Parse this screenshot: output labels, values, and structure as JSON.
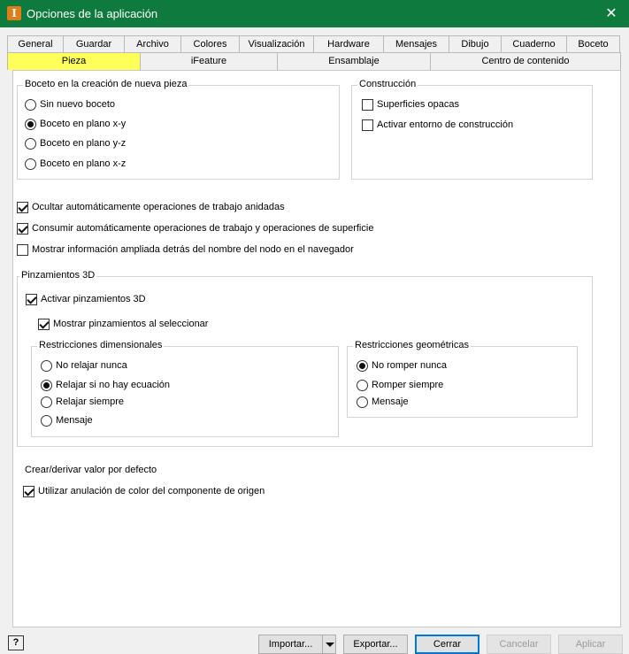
{
  "window": {
    "title": "Opciones de la aplicación",
    "icon": "inventor-app-icon",
    "icon_glyph": "I",
    "close_glyph": "✕",
    "accent_color": "#0e7a3d"
  },
  "tabs_row1": [
    {
      "label": "General"
    },
    {
      "label": "Guardar"
    },
    {
      "label": "Archivo"
    },
    {
      "label": "Colores"
    },
    {
      "label": "Visualización"
    },
    {
      "label": "Hardware"
    },
    {
      "label": "Mensajes"
    },
    {
      "label": "Dibujo"
    },
    {
      "label": "Cuaderno"
    },
    {
      "label": "Boceto"
    }
  ],
  "tabs_row2": [
    {
      "label": "Pieza",
      "active": true
    },
    {
      "label": "iFeature"
    },
    {
      "label": "Ensamblaje"
    },
    {
      "label": "Centro de contenido"
    }
  ],
  "sketch_group": {
    "legend": "Boceto en la creación de nueva pieza",
    "options": [
      {
        "label": "Sin nuevo boceto",
        "selected": false
      },
      {
        "label": "Boceto en plano x-y",
        "selected": true
      },
      {
        "label": "Boceto en plano y-z",
        "selected": false
      },
      {
        "label": "Boceto en plano x-z",
        "selected": false
      }
    ]
  },
  "construction_group": {
    "legend": "Construcción",
    "options": [
      {
        "label": "Superficies opacas",
        "checked": false
      },
      {
        "label": "Activar entorno de construcción",
        "checked": false
      }
    ]
  },
  "general_checks": [
    {
      "label": "Ocultar automáticamente operaciones de trabajo anidadas",
      "checked": true
    },
    {
      "label": "Consumir automáticamente operaciones de trabajo y operaciones de superficie",
      "checked": true
    },
    {
      "label": "Mostrar información ampliada detrás del nombre del nodo en el navegador",
      "checked": false
    }
  ],
  "grips_group": {
    "legend": "Pinzamientos 3D",
    "enable": {
      "label": "Activar pinzamientos 3D",
      "checked": true
    },
    "show_on_select": {
      "label": "Mostrar pinzamientos al seleccionar",
      "checked": true
    },
    "dimensional": {
      "legend": "Restricciones dimensionales",
      "options": [
        {
          "label": "No relajar nunca",
          "selected": false
        },
        {
          "label": "Relajar si no hay ecuación",
          "selected": true
        },
        {
          "label": "Relajar siempre",
          "selected": false
        },
        {
          "label": "Mensaje",
          "selected": false
        }
      ]
    },
    "geometric": {
      "legend": "Restricciones geométricas",
      "options": [
        {
          "label": "No romper nunca",
          "selected": true
        },
        {
          "label": "Romper siempre",
          "selected": false
        },
        {
          "label": "Mensaje",
          "selected": false
        }
      ]
    }
  },
  "derive": {
    "heading": "Crear/derivar valor por defecto",
    "option": {
      "label": "Utilizar anulación de color del componente de origen",
      "checked": true
    }
  },
  "buttons": {
    "help": "?",
    "import": "Importar...",
    "export": "Exportar...",
    "close": "Cerrar",
    "cancel": "Cancelar",
    "apply": "Aplicar"
  }
}
